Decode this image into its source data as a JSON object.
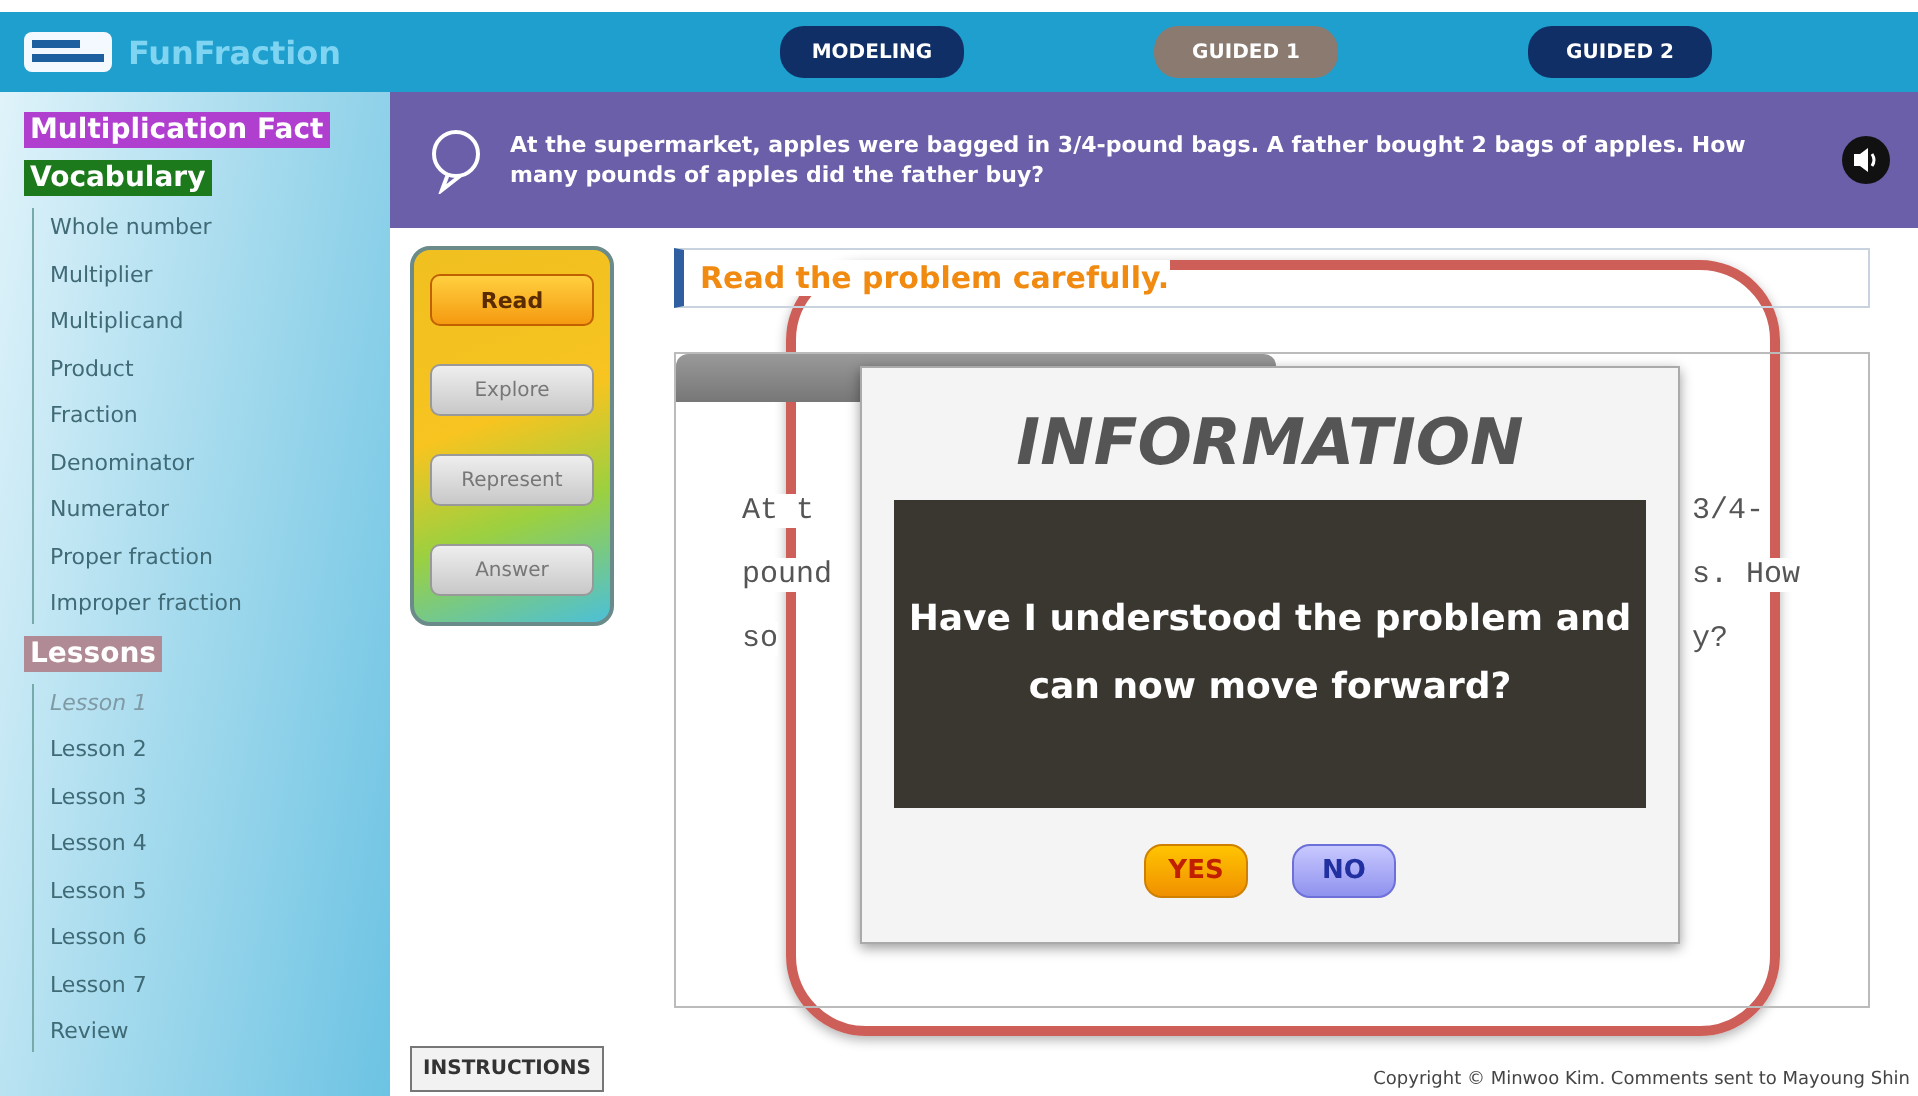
{
  "header": {
    "title": "FunFraction",
    "tabs": [
      {
        "label": "MODELING",
        "selected": false
      },
      {
        "label": "GUIDED 1",
        "selected": true
      },
      {
        "label": "GUIDED 2",
        "selected": false
      }
    ]
  },
  "sidebar": {
    "sections": [
      {
        "kind": "plain",
        "label": "Multiplication Fact",
        "color": "#b03fd0"
      },
      {
        "kind": "list",
        "label": "Vocabulary",
        "color": "#1c7a1c",
        "items": [
          {
            "label": "Whole number",
            "selected": false
          },
          {
            "label": "Multiplier",
            "selected": false
          },
          {
            "label": "Multiplicand",
            "selected": false
          },
          {
            "label": "Product",
            "selected": false
          },
          {
            "label": "Fraction",
            "selected": false
          },
          {
            "label": "Denominator",
            "selected": false
          },
          {
            "label": "Numerator",
            "selected": false
          },
          {
            "label": "Proper fraction",
            "selected": false
          },
          {
            "label": "Improper fraction",
            "selected": false
          }
        ]
      },
      {
        "kind": "list",
        "label": "Lessons",
        "color": "#b08a94",
        "items": [
          {
            "label": "Lesson 1",
            "selected": true
          },
          {
            "label": "Lesson 2",
            "selected": false
          },
          {
            "label": "Lesson 3",
            "selected": false
          },
          {
            "label": "Lesson 4",
            "selected": false
          },
          {
            "label": "Lesson 5",
            "selected": false
          },
          {
            "label": "Lesson 6",
            "selected": false
          },
          {
            "label": "Lesson 7",
            "selected": false
          },
          {
            "label": "Review",
            "selected": false
          }
        ]
      }
    ]
  },
  "question": {
    "text": "At the supermarket, apples were bagged in 3/4-pound bags. A father bought 2 bags of apples. How many pounds of apples did the father buy?"
  },
  "steps": [
    {
      "label": "Read",
      "disabled": false
    },
    {
      "label": "Explore",
      "disabled": true
    },
    {
      "label": "Represent",
      "disabled": true
    },
    {
      "label": "Answer",
      "disabled": true
    }
  ],
  "instructions_button": "INSTRUCTIONS",
  "instruction_heading": "Read the problem carefully.",
  "passage": {
    "lines": [
      {
        "left": "At t",
        "right": "3/4-"
      },
      {
        "left": "pound",
        "right": "s. How"
      },
      {
        "left": "so",
        "right": "y?"
      }
    ]
  },
  "dialog": {
    "title": "INFORMATION",
    "message": "Have I understood the problem and can now move forward?",
    "buttons": [
      {
        "label": "YES",
        "kind": "yes"
      },
      {
        "label": "NO",
        "kind": "no"
      }
    ]
  },
  "copyright": "Copyright © Minwoo Kim. Comments sent to Mayoung Shin"
}
